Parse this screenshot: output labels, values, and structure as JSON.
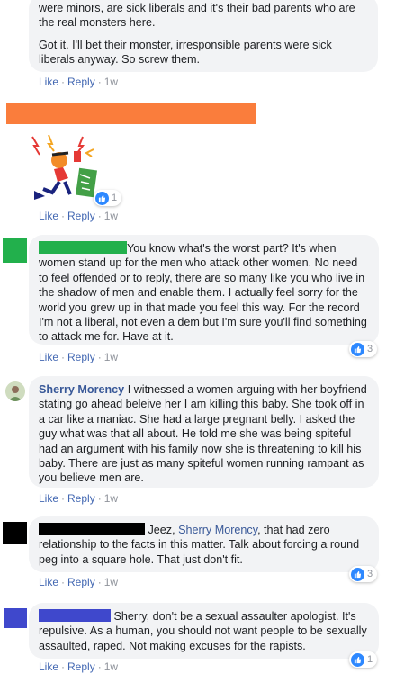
{
  "actions": {
    "like": "Like",
    "reply": "Reply",
    "dot": "·"
  },
  "comment0": {
    "line1": "were minors, are sick liberals and it's their bad parents who are the real monsters here.",
    "line2": "Got it. I'll bet their monster, irresponsible parents were sick liberals anyway. So screw them.",
    "time": "1w"
  },
  "comment1": {
    "time": "1w",
    "reactions": "1"
  },
  "comment2": {
    "text": "You know what's the worst part? It's when women stand up for the men who attack other women. No need to feel offended or to reply, there are so many like you who live in the shadow of men and enable them. I actually feel sorry for the world you grew up in that made you feel this way. For the record I'm not a liberal, not even a dem but I'm sure you'll find something to attack me for. Have at it.",
    "time": "1w",
    "reactions": "3"
  },
  "comment3": {
    "author": "Sherry Morency",
    "text": "I witnessed a women arguing with her boyfriend stating go ahead beleive her I am killing this baby. She took off in a car like a maniac. She had a large pregnant belly. I asked the guy what was that all about. He told me she was being spiteful had an argument with his family now she is threatening to kill his baby. There are just as many spiteful women running rampant as you believe men are.",
    "time": "1w"
  },
  "comment4": {
    "prefix": "Jeez,",
    "mention": "Sherry Morency",
    "text": ", that had zero relationship to the facts in this matter. Talk about forcing a round peg into a square hole. That just don't fit.",
    "time": "1w",
    "reactions": "3"
  },
  "comment5": {
    "text": "Sherry, don't be a sexual assaulter apologist. It's repulsive. As a human, you should not want people to be sexually assaulted, raped. Not making excuses for the rapists.",
    "time": "1w",
    "reactions": "1"
  },
  "colors": {
    "redact_orange": "#fa7d3c",
    "redact_green": "#22b04c",
    "redact_black": "#000000",
    "redact_blue": "#3f48cc",
    "link_blue": "#4267b2",
    "name_blue": "#385898",
    "bubble_gray": "#f2f3f5"
  },
  "icons": [
    "thumbs-up-icon",
    "cartoon-sticker",
    "avatar"
  ]
}
